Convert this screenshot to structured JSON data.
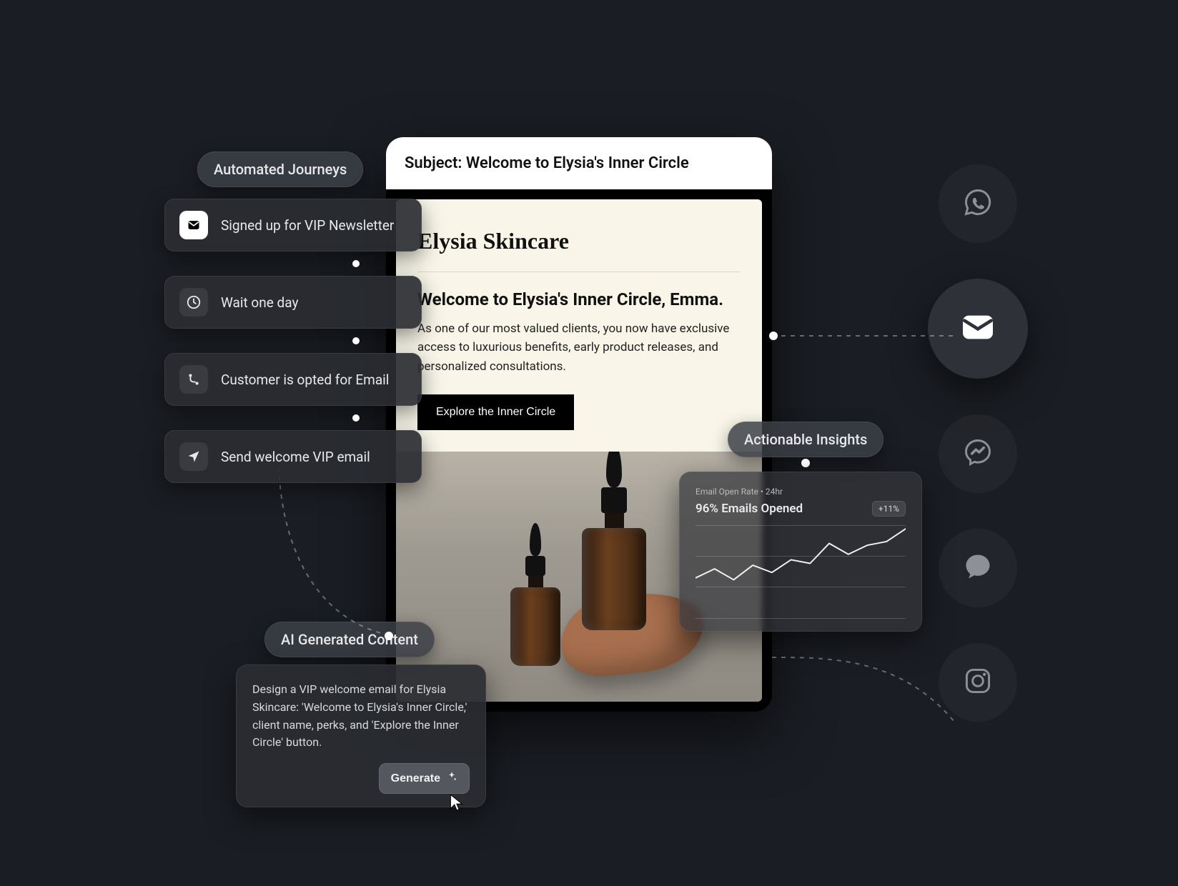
{
  "labels": {
    "automated_journeys": "Automated Journeys",
    "actionable_insights": "Actionable Insights",
    "ai_generated_content": "AI Generated Content"
  },
  "journey": {
    "steps": [
      {
        "icon": "mail-icon",
        "label": "Signed up for VIP Newsletter"
      },
      {
        "icon": "clock-icon",
        "label": "Wait one day"
      },
      {
        "icon": "branch-icon",
        "label": "Customer is opted for Email"
      },
      {
        "icon": "send-icon",
        "label": "Send welcome VIP email"
      }
    ]
  },
  "email": {
    "subject_prefix": "Subject: ",
    "subject": "Welcome to Elysia's Inner Circle",
    "brand": "Elysia Skincare",
    "headline": "Welcome to Elysia's Inner Circle, Emma.",
    "body": "As one of our most valued clients, you now have exclusive access to luxurious benefits, early product releases, and personalized consultations.",
    "cta": "Explore the Inner Circle"
  },
  "ai": {
    "prompt": "Design a VIP welcome email for Elysia Skincare: 'Welcome to Elysia's Inner Circle,' client name, perks, and 'Explore the Inner Circle' button.",
    "generate_label": "Generate"
  },
  "insights": {
    "subtitle": "Email Open Rate • 24hr",
    "title": "96% Emails Opened",
    "delta": "+11%"
  },
  "channels": [
    {
      "name": "whatsapp-icon",
      "active": false
    },
    {
      "name": "mail-icon",
      "active": true
    },
    {
      "name": "messenger-icon",
      "active": false
    },
    {
      "name": "chat-icon",
      "active": false
    },
    {
      "name": "instagram-icon",
      "active": false
    }
  ],
  "chart_data": {
    "type": "line",
    "title": "Email Open Rate • 24hr",
    "xlabel": "",
    "ylabel": "",
    "ylim": [
      0,
      100
    ],
    "x": [
      0,
      1,
      2,
      3,
      4,
      5,
      6,
      7,
      8,
      9,
      10,
      11
    ],
    "values": [
      42,
      52,
      40,
      56,
      48,
      62,
      58,
      80,
      68,
      78,
      82,
      96
    ]
  }
}
